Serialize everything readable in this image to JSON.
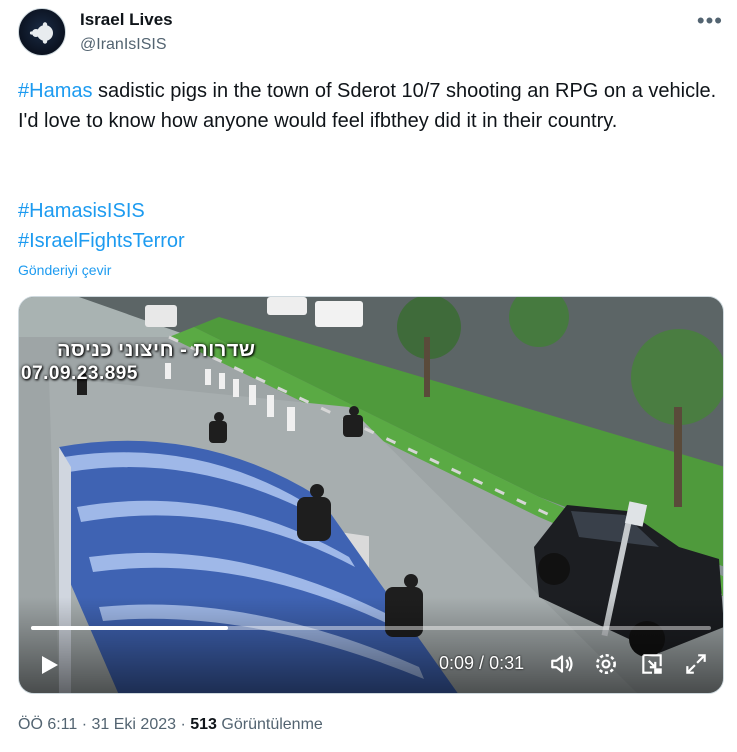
{
  "author": {
    "name": "Israel Lives",
    "handle": "@IranIsISIS"
  },
  "tweet": {
    "hashtag_lead": "#Hamas",
    "text_body": " sadistic pigs in the town of Sderot 10/7 shooting an RPG on a vehicle. I'd love to know how anyone would feel ifbthey did it in their country.",
    "tags": [
      "#HamasisISIS",
      "#IsraelFightsTerror"
    ],
    "translate_label": "Gönderiyi çevir"
  },
  "video": {
    "overlay_hebrew": "שדרות - חיצוני כניסה",
    "overlay_timestamp": "07.09.23.895",
    "current_time": "0:09",
    "separator": " / ",
    "duration": "0:31",
    "progress": 0.29
  },
  "meta": {
    "time": "ÖÖ 6:11",
    "dot1": " · ",
    "date": "31 Eki 2023",
    "dot2": " · ",
    "views": "513",
    "views_label": " Görüntülenme"
  },
  "colors": {
    "accent": "#1d9bf0",
    "text": "#0f1419",
    "muted": "#536471"
  }
}
